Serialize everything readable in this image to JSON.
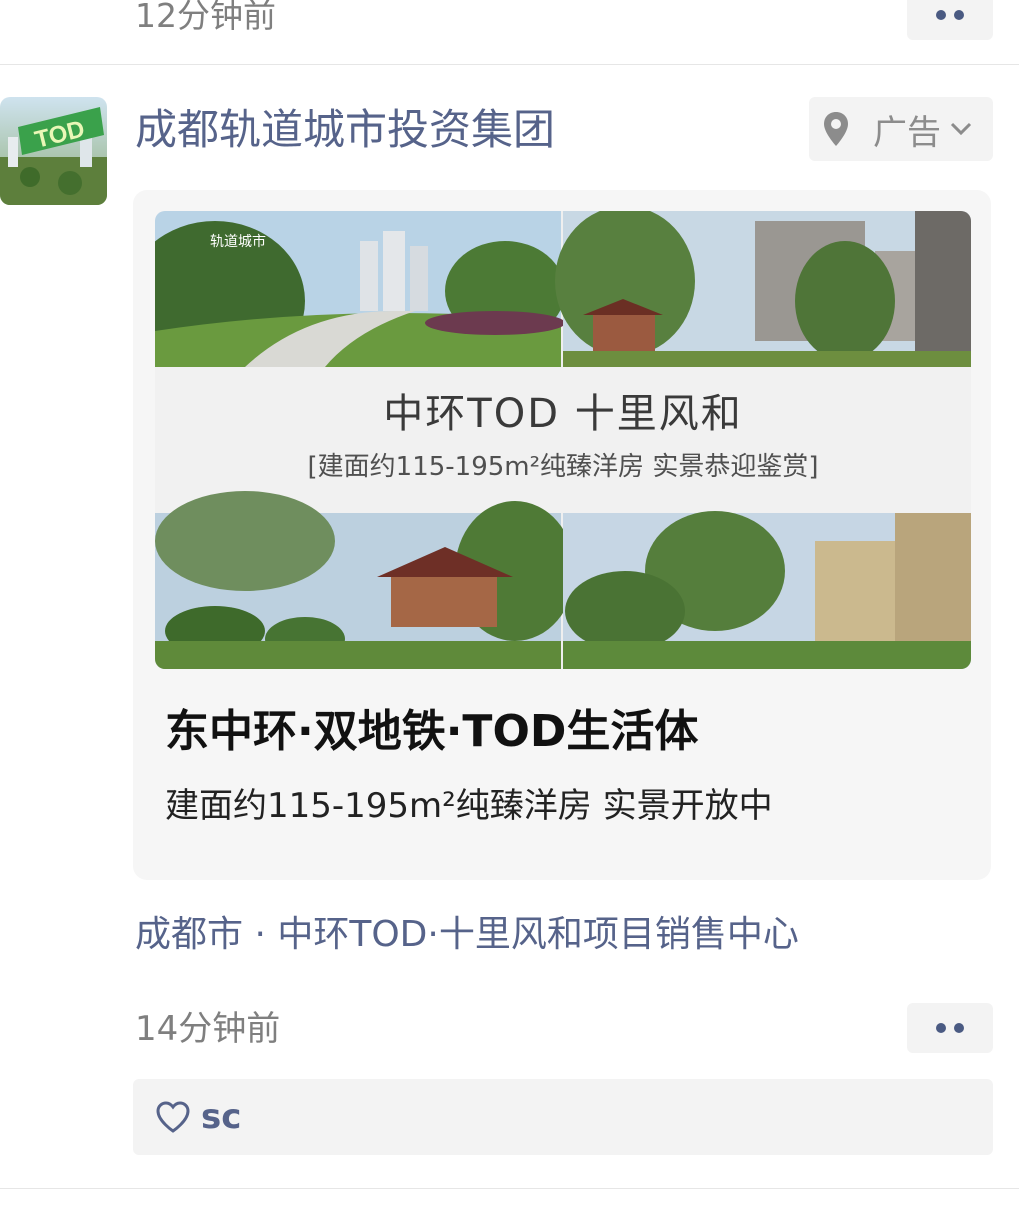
{
  "previous_post": {
    "time": "12分钟前"
  },
  "post": {
    "author": "成都轨道城市投资集团",
    "ad_label": "广告",
    "avatar_text": "TOD",
    "banner": {
      "brand": "轨道城市",
      "title": "中环TOD 十里风和",
      "subtitle": "[建面约115-195m²纯臻洋房 实景恭迎鉴赏]"
    },
    "card_title": "东中环·双地铁·TOD生活体",
    "card_desc": "建面约115-195m²纯臻洋房 实景开放中",
    "location": "成都市 · 中环TOD·十里风和项目销售中心",
    "time": "14分钟前",
    "likes": {
      "names": "sc"
    }
  },
  "colors": {
    "link": "#56638a",
    "meta": "#7f7f7f",
    "chip_bg": "#f3f3f3"
  },
  "icons": [
    "more-dots-icon",
    "location-pin-icon",
    "chevron-down-icon",
    "heart-icon"
  ]
}
